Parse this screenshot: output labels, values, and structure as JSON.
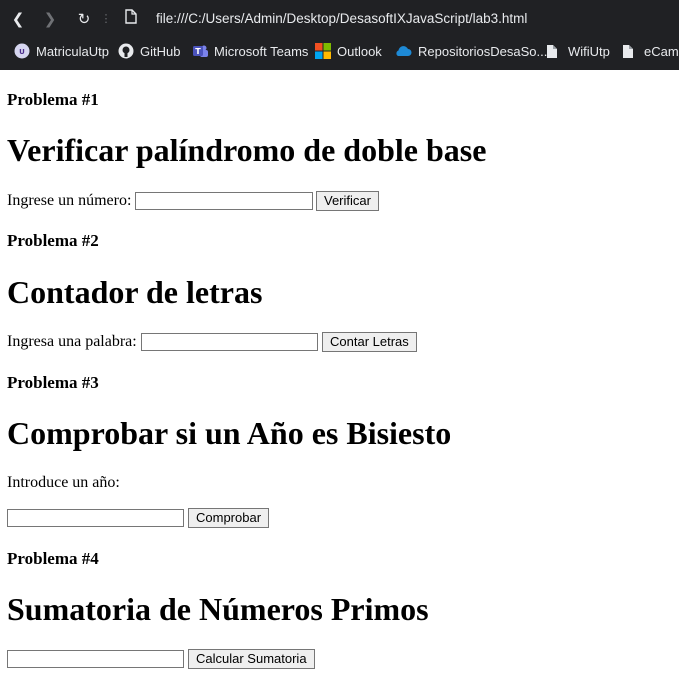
{
  "browser": {
    "url": "file:///C:/Users/Admin/Desktop/DesasoftIXJavaScript/lab3.html",
    "nav_icons": [
      "back-icon",
      "forward-icon",
      "reload-icon",
      "file-icon"
    ],
    "bookmarks": [
      {
        "label": "MatriculaUtp",
        "icon": "utp-logo-icon"
      },
      {
        "label": "GitHub",
        "icon": "github-icon"
      },
      {
        "label": "Microsoft Teams",
        "icon": "teams-icon"
      },
      {
        "label": "Outlook",
        "icon": "microsoft-logo-icon"
      },
      {
        "label": "RepositoriosDesaSo...",
        "icon": "cloud-icon"
      },
      {
        "label": "WifiUtp",
        "icon": "file-icon"
      },
      {
        "label": "eCamp",
        "icon": "file-icon"
      }
    ]
  },
  "problems": [
    {
      "heading": "Problema #1",
      "title": "Verificar palíndromo de doble base",
      "label": "Ingrese un número:",
      "button": "Verificar"
    },
    {
      "heading": "Problema #2",
      "title": "Contador de letras",
      "label": "Ingresa una palabra:",
      "button": "Contar Letras"
    },
    {
      "heading": "Problema #3",
      "title": "Comprobar si un Año es Bisiesto",
      "label": "Introduce un año:",
      "button": "Comprobar"
    },
    {
      "heading": "Problema #4",
      "title": "Sumatoria de Números Primos",
      "button": "Calcular Sumatoria"
    }
  ]
}
